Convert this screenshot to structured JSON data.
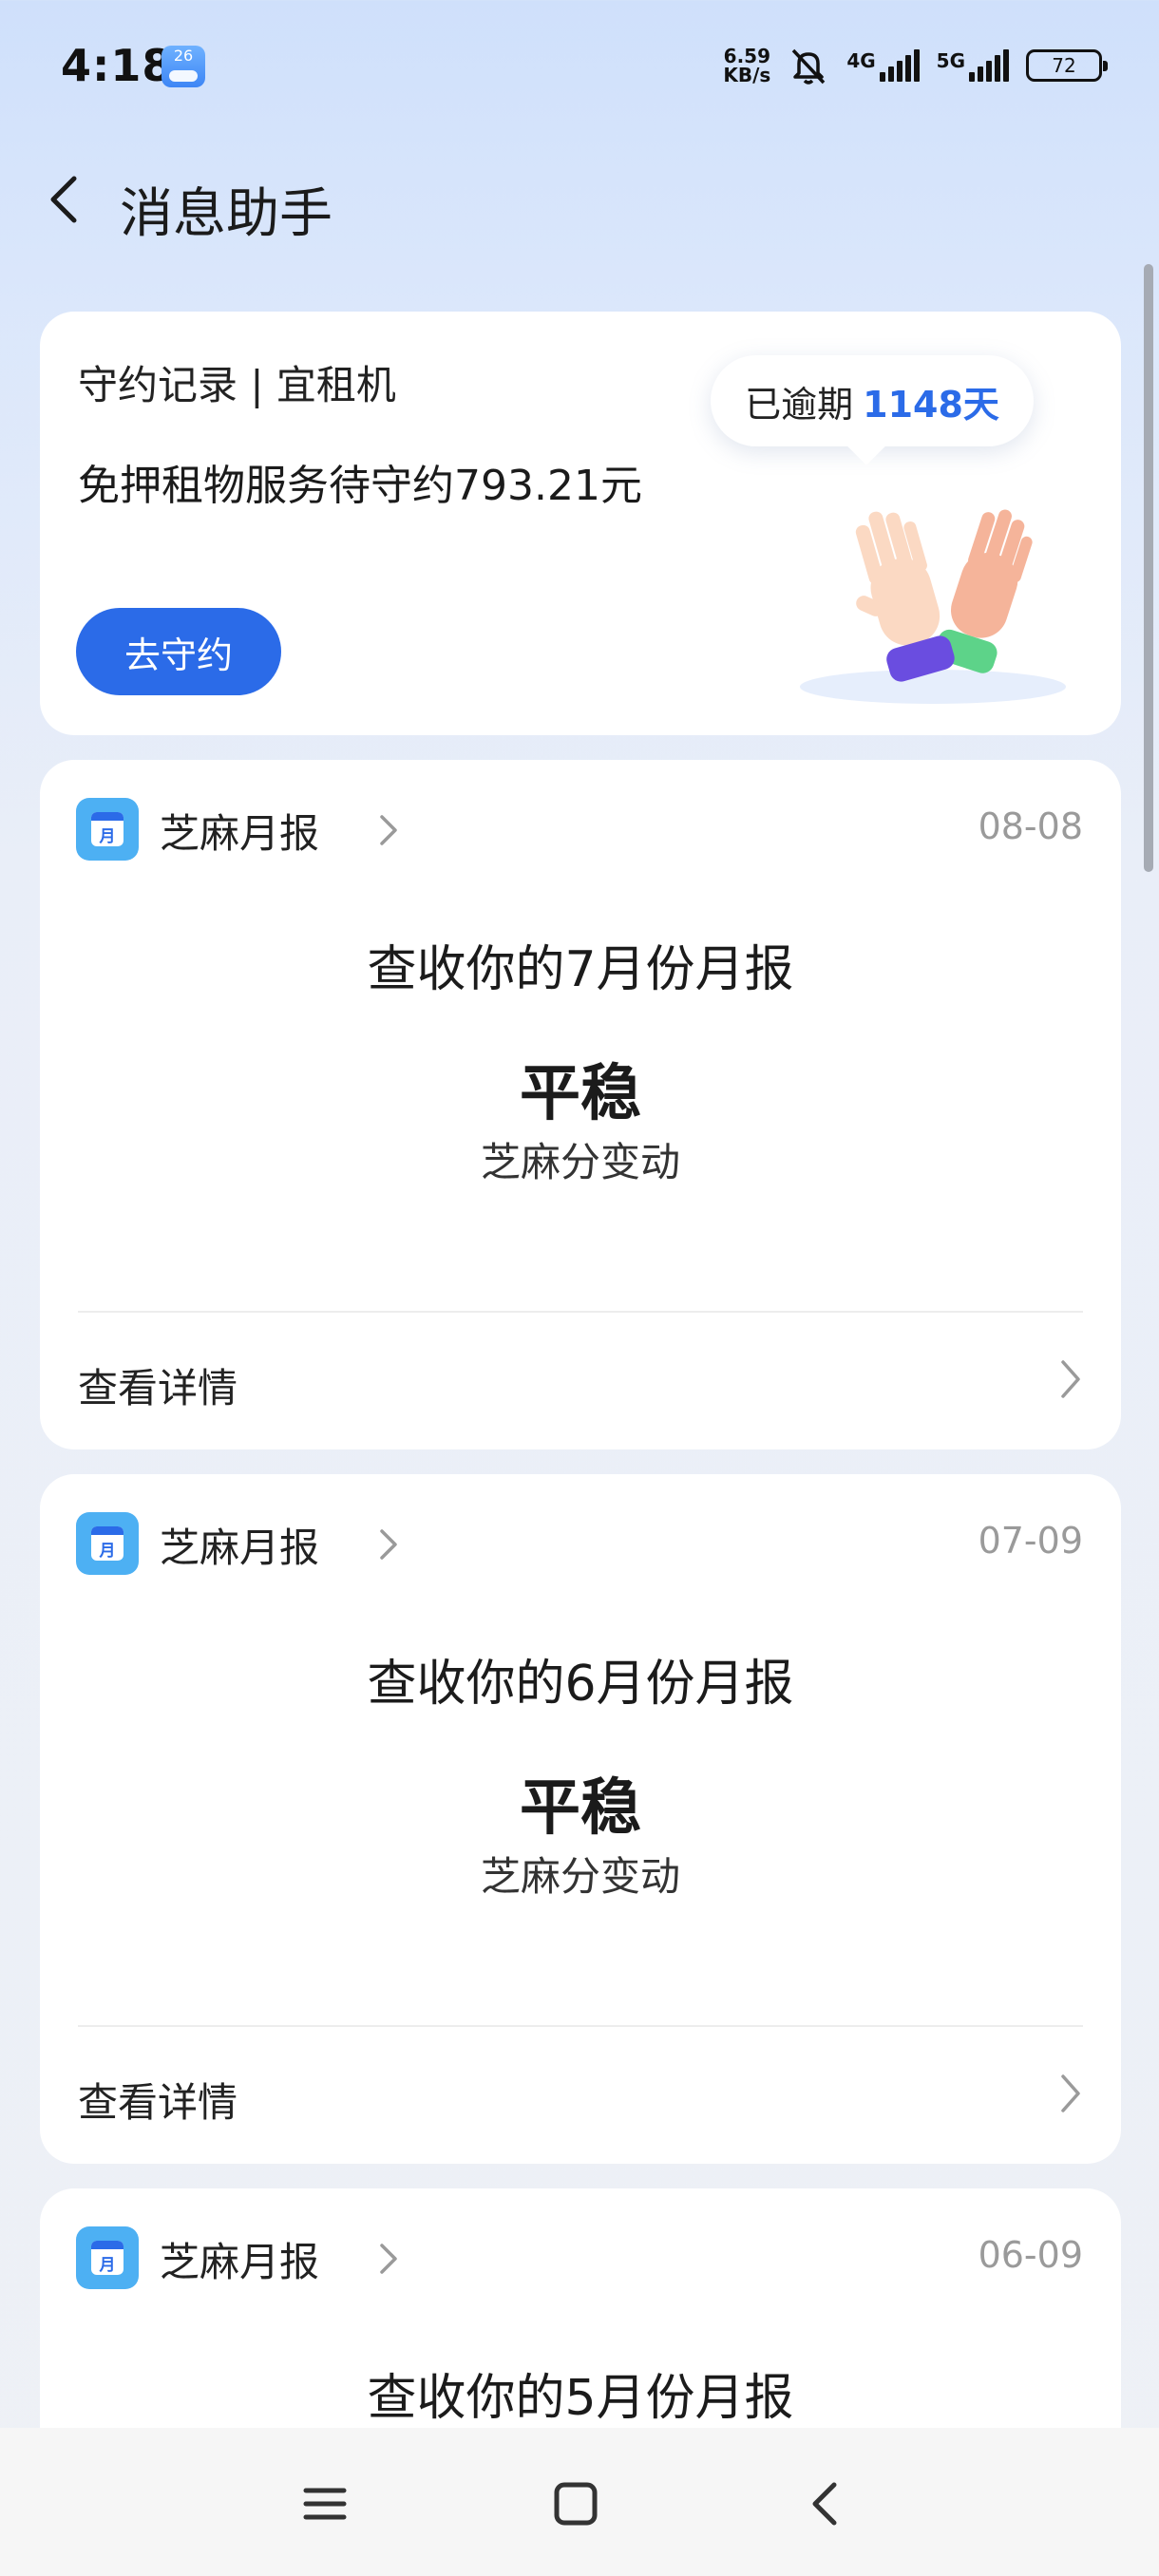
{
  "status_bar": {
    "time": "4:18",
    "weather_badge": "26",
    "speed_value": "6.59",
    "speed_unit": "KB/s",
    "net1": "4G",
    "net2": "5G",
    "battery": "72"
  },
  "header": {
    "title": "消息助手",
    "back_icon": "chevron-left-icon"
  },
  "promise_card": {
    "title": "守约记录 | 宜租机",
    "description": "免押租物服务待守约793.21元",
    "button": "去守约",
    "overdue_prefix": "已逾期",
    "overdue_days": "1148天"
  },
  "reports": [
    {
      "source": "芝麻月报",
      "icon_text": "月",
      "date": "08-08",
      "heading": "查收你的7月份月报",
      "status": "平稳",
      "subtitle": "芝麻分变动",
      "details": "查看详情"
    },
    {
      "source": "芝麻月报",
      "icon_text": "月",
      "date": "07-09",
      "heading": "查收你的6月份月报",
      "status": "平稳",
      "subtitle": "芝麻分变动",
      "details": "查看详情"
    },
    {
      "source": "芝麻月报",
      "icon_text": "月",
      "date": "06-09",
      "heading": "查收你的5月份月报"
    }
  ],
  "nav": {
    "menu_icon": "menu-icon",
    "home_icon": "home-square-icon",
    "back_icon": "back-triangle-icon"
  },
  "colors": {
    "accent": "#2b6be8",
    "background_top": "#cfe0fb",
    "date_gray": "#9a9a9a"
  }
}
